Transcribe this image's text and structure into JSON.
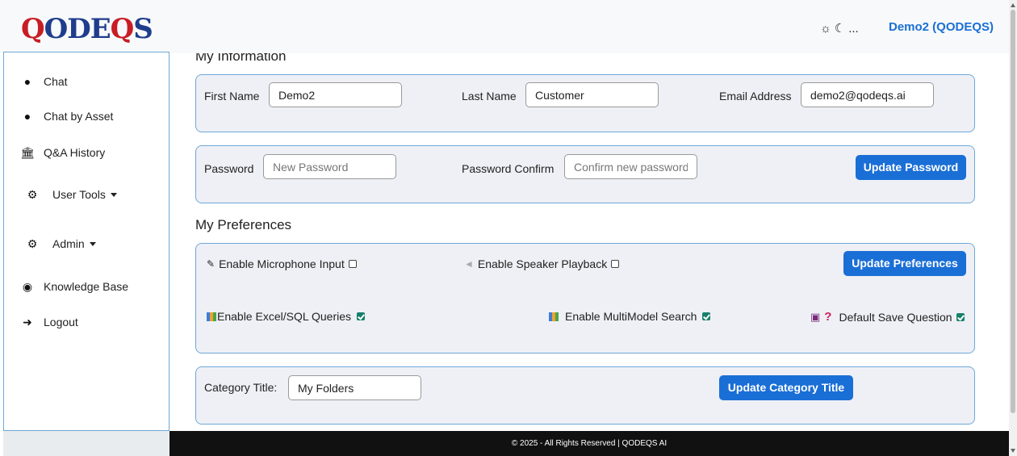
{
  "header": {
    "logo": {
      "q1": "Q",
      "mid": "ODE",
      "q2": "Q",
      "end": "S"
    },
    "theme_icons": {
      "sun": "☼",
      "moon": "☾",
      "more": "..."
    },
    "user": "Demo2 (QODEQS)"
  },
  "sidebar": {
    "items": [
      {
        "icon": "chat-bubble-icon",
        "glyph": "💬",
        "label": "Chat"
      },
      {
        "icon": "chat-bubble-icon",
        "glyph": "💬",
        "label": "Chat by Asset"
      },
      {
        "icon": "institution-icon",
        "glyph": "🏛",
        "label": "Q&A History"
      },
      {
        "icon": "cogs-icon",
        "glyph": "⚙",
        "label": "User Tools"
      },
      {
        "icon": "cogs-icon",
        "glyph": "⚙",
        "label": "Admin"
      },
      {
        "icon": "brain-icon",
        "glyph": "●",
        "label": "Knowledge Base"
      },
      {
        "icon": "sign-out-icon",
        "glyph": "➜",
        "label": "Logout"
      }
    ]
  },
  "my_information": {
    "title": "My Information",
    "first_name_label": "First Name",
    "first_name_value": "Demo2",
    "last_name_label": "Last Name",
    "last_name_value": "Customer",
    "email_label": "Email Address",
    "email_value": "demo2@qodeqs.ai"
  },
  "password": {
    "password_label": "Password",
    "password_placeholder": "New Password",
    "confirm_label": "Password Confirm",
    "confirm_placeholder": "Confirm new password",
    "update_button": "Update Password"
  },
  "preferences": {
    "title": "My Preferences",
    "microphone_label": "Enable Microphone Input",
    "microphone_checked": false,
    "speaker_label": "Enable Speaker Playback",
    "speaker_checked": false,
    "update_button": "Update Preferences",
    "excel_label": "Enable Excel/SQL Queries",
    "excel_checked": true,
    "multimodel_label": "Enable MultiModel Search",
    "multimodel_checked": true,
    "save_question_label": "Default Save Question",
    "save_question_checked": true
  },
  "category": {
    "label": "Category Title:",
    "value": "My Folders",
    "update_button": "Update Category Title"
  },
  "footer": {
    "text": "© 2025 - All Rights Reserved | QODEQS AI"
  }
}
